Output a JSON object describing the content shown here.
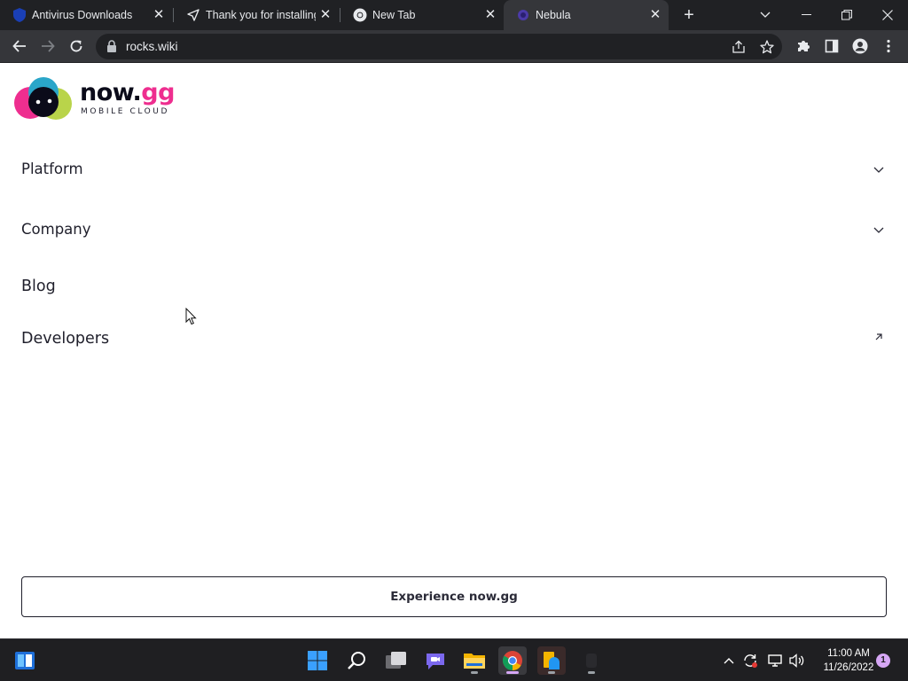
{
  "browser": {
    "tabs": [
      {
        "title": "Antivirus Downloads",
        "favicon": "shield-icon",
        "active": false
      },
      {
        "title": "Thank you for installing",
        "favicon": "arrow-icon",
        "active": false
      },
      {
        "title": "New Tab",
        "favicon": "chrome-icon",
        "active": false
      },
      {
        "title": "Nebula",
        "favicon": "nebula-icon",
        "active": true
      }
    ],
    "url": "rocks.wiki"
  },
  "page": {
    "logo": {
      "word_main": "now.",
      "word_accent": "gg",
      "subtitle": "MOBILE CLOUD"
    },
    "nav": [
      {
        "label": "Platform",
        "icon": "chevron-down-icon"
      },
      {
        "label": "Company",
        "icon": "chevron-down-icon"
      },
      {
        "label": "Blog",
        "icon": ""
      },
      {
        "label": "Developers",
        "icon": "external-link-icon"
      }
    ],
    "cta_label": "Experience now.gg"
  },
  "taskbar": {
    "time": "11:00 AM",
    "date": "11/26/2022",
    "notification_count": "1"
  },
  "colors": {
    "accent_pink": "#ee2e8f",
    "chrome_dark": "#202124",
    "chrome_toolbar": "#35363a"
  }
}
